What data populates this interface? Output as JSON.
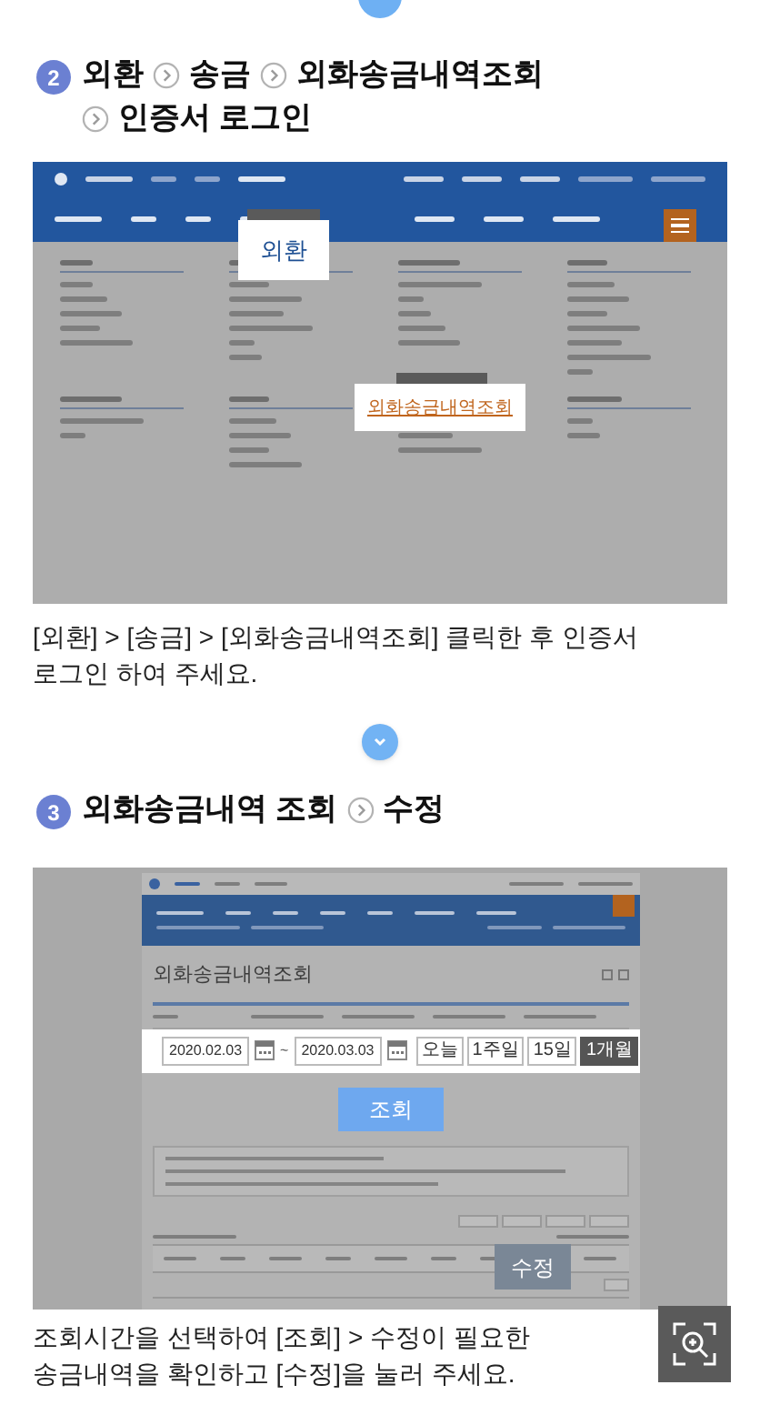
{
  "steps": [
    {
      "number": "2",
      "path": [
        "외환",
        "송금",
        "외화송금내역조회",
        "인증서 로그인"
      ],
      "screenshot": {
        "kind": "menu",
        "menu_callout": "외환",
        "link_callout": "외화송금내역조회"
      },
      "caption": "[외환] > [송금] > [외화송금내역조회] 클릭한 후 인증서 로그인 하여 주세요."
    },
    {
      "number": "3",
      "path": [
        "외화송금내역 조회",
        "수정"
      ],
      "screenshot": {
        "kind": "form",
        "title": "외화송금내역조회",
        "date_from": "2020.02.03",
        "separator": "~",
        "date_to": "2020.03.03",
        "periods": [
          {
            "label": "오늘",
            "selected": false
          },
          {
            "label": "1주일",
            "selected": false
          },
          {
            "label": "15일",
            "selected": false
          },
          {
            "label": "1개월",
            "selected": true
          }
        ],
        "search_callout": "조회",
        "edit_callout": "수정"
      },
      "caption": "조회시간을 선택하여 [조회] > 수정이 필요한 송금내역을 확인하고 [수정]을 눌러 주세요."
    }
  ]
}
